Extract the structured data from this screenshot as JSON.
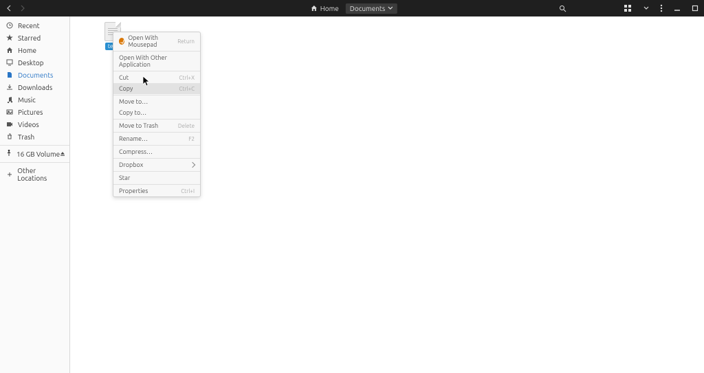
{
  "topbar": {
    "breadcrumbs": [
      {
        "label": "Home"
      },
      {
        "label": "Documents"
      }
    ]
  },
  "sidebar": {
    "items": [
      {
        "label": "Recent",
        "icon": "clock"
      },
      {
        "label": "Starred",
        "icon": "star"
      },
      {
        "label": "Home",
        "icon": "home"
      },
      {
        "label": "Desktop",
        "icon": "desktop"
      },
      {
        "label": "Documents",
        "icon": "documents",
        "active": true
      },
      {
        "label": "Downloads",
        "icon": "download"
      },
      {
        "label": "Music",
        "icon": "music"
      },
      {
        "label": "Pictures",
        "icon": "pictures"
      },
      {
        "label": "Videos",
        "icon": "videos"
      },
      {
        "label": "Trash",
        "icon": "trash"
      }
    ],
    "volume": {
      "label": "16 GB Volume"
    },
    "other": {
      "label": "Other Locations"
    }
  },
  "file": {
    "name": "test"
  },
  "context_menu": {
    "open_with_mousepad": "Open With Mousepad",
    "open_with_mousepad_accel": "Return",
    "open_with_other": "Open With Other Application",
    "cut": "Cut",
    "cut_accel": "Ctrl+X",
    "copy": "Copy",
    "copy_accel": "Ctrl+C",
    "move_to": "Move to…",
    "copy_to": "Copy to…",
    "move_to_trash": "Move to Trash",
    "move_to_trash_accel": "Delete",
    "rename": "Rename…",
    "rename_accel": "F2",
    "compress": "Compress…",
    "dropbox": "Dropbox",
    "star": "Star",
    "properties": "Properties",
    "properties_accel": "Ctrl+I"
  }
}
